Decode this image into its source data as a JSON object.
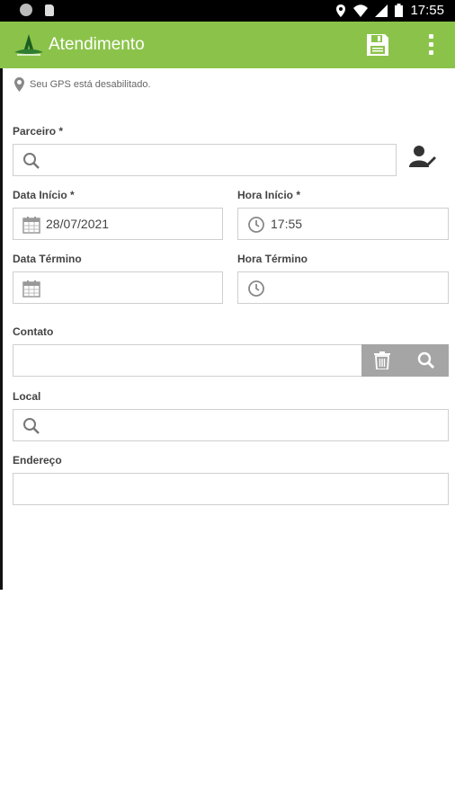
{
  "status_bar": {
    "time": "17:55"
  },
  "app_bar": {
    "title": "Atendimento"
  },
  "gps_message": "Seu GPS está desabilitado.",
  "form": {
    "parceiro": {
      "label": "Parceiro *",
      "value": ""
    },
    "data_inicio": {
      "label": "Data Início *",
      "value": "28/07/2021"
    },
    "hora_inicio": {
      "label": "Hora Início *",
      "value": "17:55"
    },
    "data_termino": {
      "label": "Data Término",
      "value": ""
    },
    "hora_termino": {
      "label": "Hora Término",
      "value": ""
    },
    "contato": {
      "label": "Contato",
      "value": ""
    },
    "local": {
      "label": "Local",
      "value": ""
    },
    "endereco": {
      "label": "Endereço",
      "value": ""
    }
  },
  "colors": {
    "app_bar": "#8bc34a",
    "grey_buttons": "#a5a5a5"
  }
}
